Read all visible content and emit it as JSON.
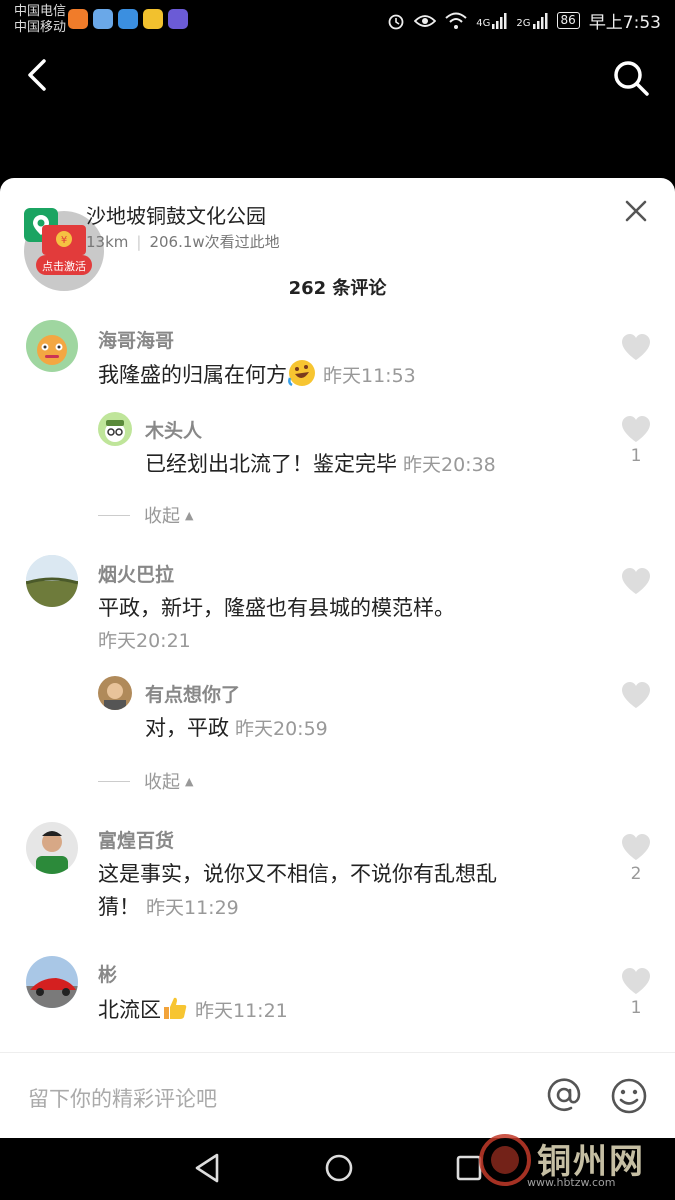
{
  "status_bar": {
    "carrier1": "中国电信",
    "carrier2": "中国移动",
    "signal1": "4G",
    "signal2": "2G",
    "battery": "86",
    "time": "早上7:53"
  },
  "location": {
    "name": "沙地坡铜鼓文化公园",
    "distance": "13km",
    "views": "206.1w次看过此地",
    "red_packet_label": "点击激活"
  },
  "comment_count": "262 条评论",
  "comments": [
    {
      "name": "海哥海哥",
      "text": "我隆盛的归属在何方",
      "emoji": "rofl-emoji",
      "time": "昨天11:53",
      "likes": "",
      "replies": [
        {
          "name": "木头人",
          "text": "已经划出北流了！鉴定完毕",
          "time": "昨天20:38",
          "likes": "1"
        }
      ],
      "collapse": "收起"
    },
    {
      "name": "烟火巴拉",
      "text": "平政，新圩，隆盛也有县城的模范样。",
      "time": "昨天20:21",
      "likes": "",
      "replies": [
        {
          "name": "有点想你了",
          "text": "对，平政",
          "time": "昨天20:59",
          "likes": ""
        }
      ],
      "collapse": "收起"
    },
    {
      "name": "富煌百货",
      "text_line1": "这是事实，说你又不相信，不说你有乱想乱",
      "text_line2": "猜！",
      "time": "昨天11:29",
      "likes": "2"
    },
    {
      "name": "彬",
      "text": "北流区",
      "emoji": "thumbs-up-emoji",
      "time": "昨天11:21",
      "likes": "1"
    }
  ],
  "input": {
    "placeholder": "留下你的精彩评论吧"
  },
  "watermark": {
    "text": "铜州网",
    "url": "www.hbtzw.com"
  },
  "colors": {
    "accent_red": "#e23b3b",
    "pin_green": "#1ba462",
    "heart_grey": "#ddd"
  }
}
